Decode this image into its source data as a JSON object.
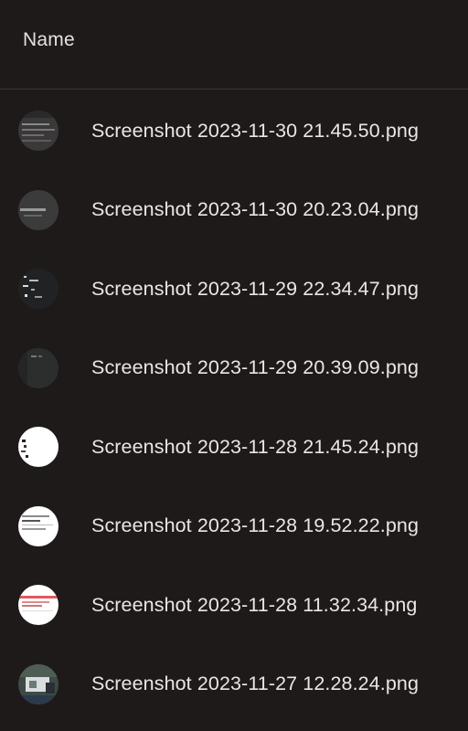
{
  "header": {
    "column_label": "Name"
  },
  "files": [
    {
      "name": "Screenshot 2023-11-30 21.45.50.png",
      "thumbnail": "dark-screenshot-thumbnail"
    },
    {
      "name": "Screenshot 2023-11-30 20.23.04.png",
      "thumbnail": "dark-screenshot-thumbnail"
    },
    {
      "name": "Screenshot 2023-11-29 22.34.47.png",
      "thumbnail": "dark-terminal-thumbnail"
    },
    {
      "name": "Screenshot 2023-11-29 20.39.09.png",
      "thumbnail": "dark-screenshot-thumbnail"
    },
    {
      "name": "Screenshot 2023-11-28 21.45.24.png",
      "thumbnail": "light-screenshot-thumbnail"
    },
    {
      "name": "Screenshot 2023-11-28 19.52.22.png",
      "thumbnail": "light-screenshot-thumbnail"
    },
    {
      "name": "Screenshot 2023-11-28 11.32.34.png",
      "thumbnail": "light-red-screenshot-thumbnail"
    },
    {
      "name": "Screenshot 2023-11-27 12.28.24.png",
      "thumbnail": "photo-screenshot-thumbnail"
    }
  ]
}
